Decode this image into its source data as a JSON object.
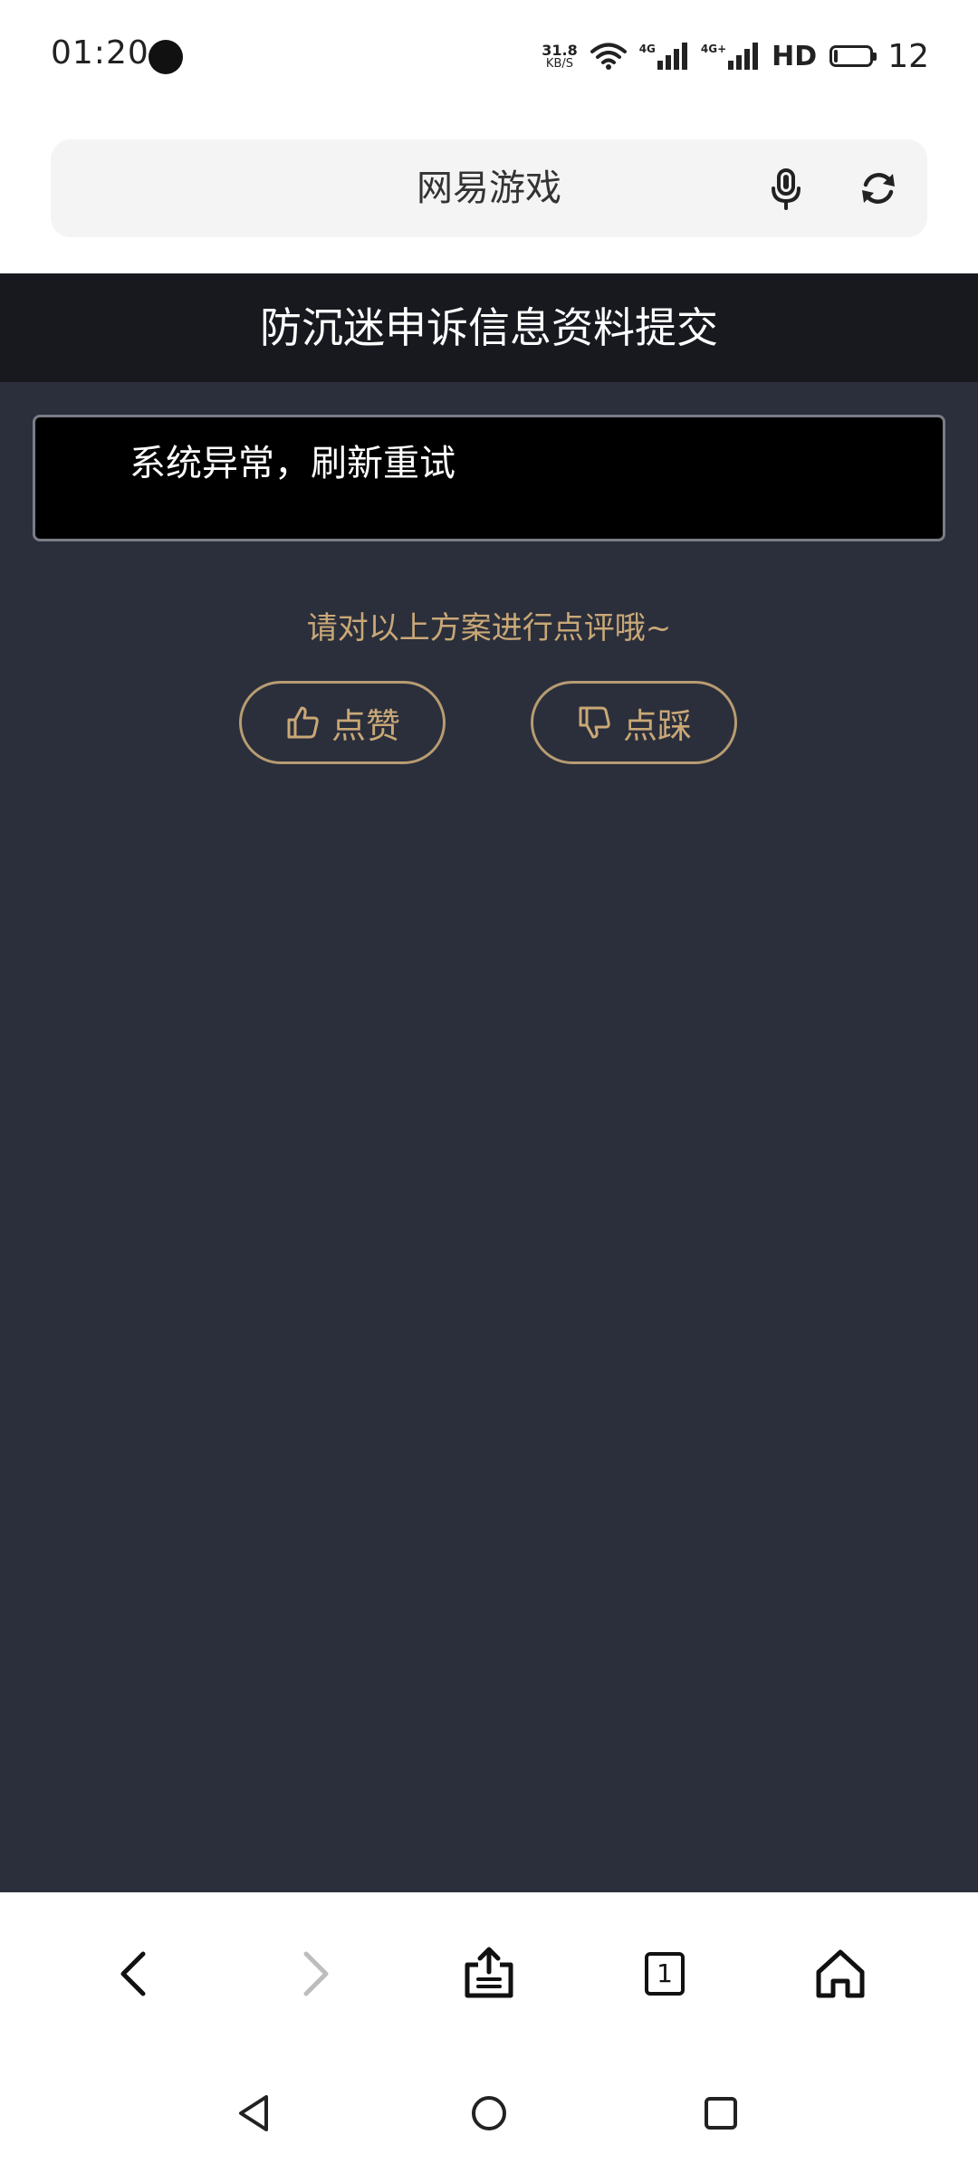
{
  "status_bar": {
    "time": "01:20",
    "net_speed_value": "31.8",
    "net_speed_unit": "KB/S",
    "signal1_label": "4G",
    "signal2_label": "4G+",
    "hd_label": "HD",
    "battery_level": "12"
  },
  "browser": {
    "url_text": "网易游戏",
    "mic_icon": "mic-icon",
    "refresh_icon": "refresh-icon"
  },
  "page": {
    "title": "防沉迷申诉信息资料提交",
    "message": "系统异常，刷新重试",
    "rating_prompt": "请对以上方案进行点评哦~",
    "like_label": "点赞",
    "dislike_label": "点踩"
  },
  "toolbar": {
    "tab_count": "1"
  },
  "colors": {
    "header_bg": "#17191f",
    "content_bg": "#2b2f3b",
    "accent_gold": "#c9a877",
    "message_bg": "#000000"
  }
}
